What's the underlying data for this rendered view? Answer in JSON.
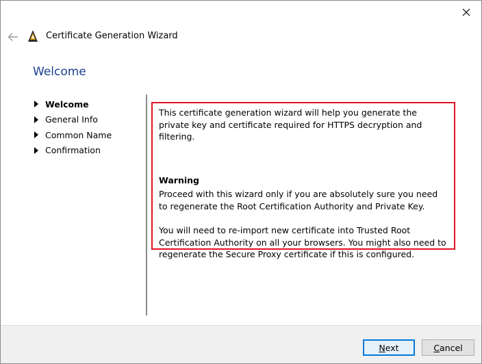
{
  "window": {
    "title": "Certificate Generation Wizard"
  },
  "page": {
    "title": "Welcome"
  },
  "steps": [
    {
      "label": "Welcome",
      "active": true
    },
    {
      "label": "General Info",
      "active": false
    },
    {
      "label": "Common Name",
      "active": false
    },
    {
      "label": "Confirmation",
      "active": false
    }
  ],
  "content": {
    "intro": "This certificate generation wizard will help you generate the private key and certificate required for HTTPS decryption and filtering.",
    "warning_heading": "Warning",
    "warning_1": "Proceed with this wizard only if you are absolutely sure you need to regenerate the Root Certification Authority and Private Key.",
    "warning_2": "You will need to re-import new certificate into Trusted Root Certification Authority on all your browsers. You might also need to regenerate the Secure Proxy certificate if this is configured."
  },
  "buttons": {
    "next_accel": "N",
    "next_rest": "ext",
    "cancel_accel": "C",
    "cancel_rest": "ancel"
  },
  "icons": {
    "close": "close-icon",
    "back": "back-arrow-icon",
    "app": "app-logo-icon"
  },
  "colors": {
    "title_blue": "#1a3e92",
    "highlight_red": "#e0121f",
    "focus_blue": "#0078d7"
  }
}
